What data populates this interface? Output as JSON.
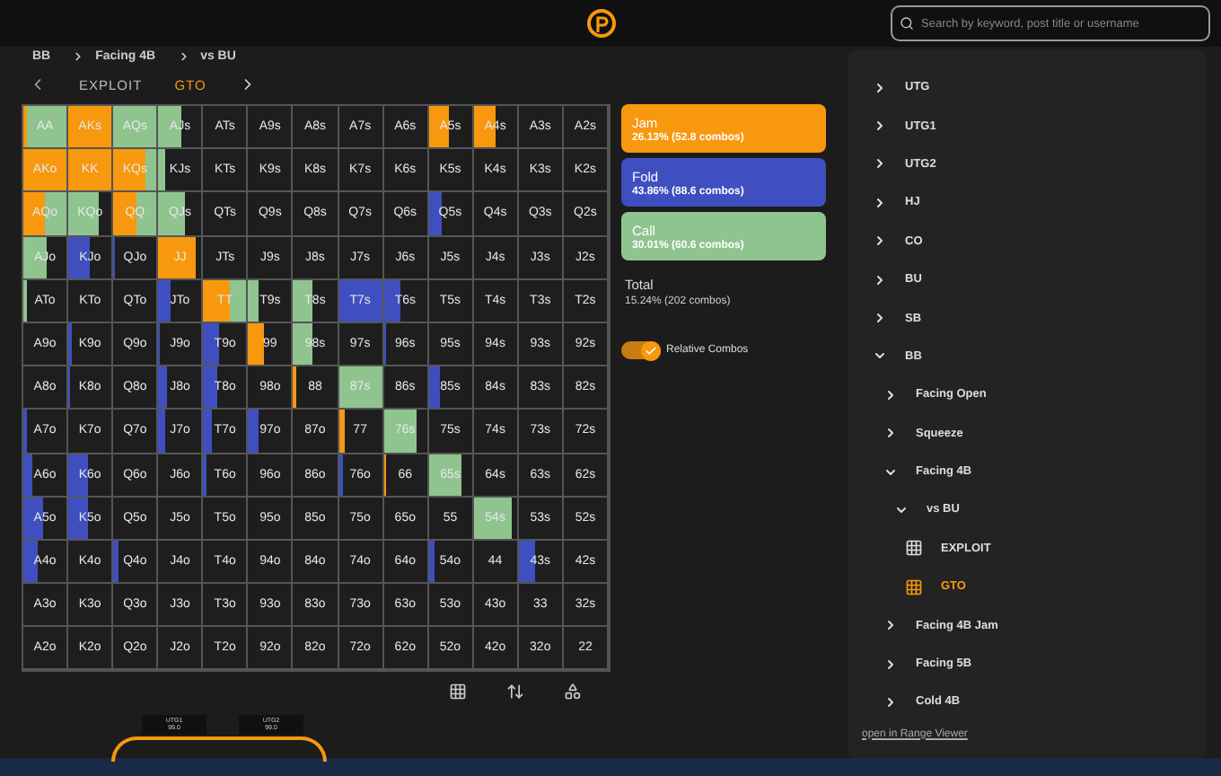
{
  "search": {
    "placeholder": "Search by keyword, post title or username"
  },
  "breadcrumbs": [
    "BB",
    "Facing 4B",
    "vs BU"
  ],
  "tabs": [
    {
      "label": "EXPLOIT",
      "selected": false
    },
    {
      "label": "GTO",
      "selected": true
    }
  ],
  "grid": [
    [
      {
        "hand": "AA",
        "mix": [
          {
            "kind": "jam",
            "level": 0.1
          },
          {
            "kind": "call",
            "level": 0.9
          }
        ]
      },
      {
        "hand": "AKs",
        "mix": [
          {
            "kind": "jam",
            "level": 1
          }
        ]
      },
      {
        "hand": "AQs",
        "mix": [
          {
            "kind": "call",
            "level": 1
          }
        ]
      },
      {
        "hand": "AJs",
        "mix": [
          {
            "kind": "call",
            "level": 0.55
          }
        ]
      },
      {
        "hand": "ATs"
      },
      {
        "hand": "A9s"
      },
      {
        "hand": "A8s"
      },
      {
        "hand": "A7s"
      },
      {
        "hand": "A6s"
      },
      {
        "hand": "A5s",
        "mix": [
          {
            "kind": "jam",
            "level": 0.45
          }
        ]
      },
      {
        "hand": "A4s",
        "mix": [
          {
            "kind": "jam",
            "level": 0.5
          }
        ]
      },
      {
        "hand": "A3s"
      },
      {
        "hand": "A2s"
      }
    ],
    [
      {
        "hand": "AKo",
        "mix": [
          {
            "kind": "jam",
            "level": 1
          }
        ]
      },
      {
        "hand": "KK",
        "mix": [
          {
            "kind": "jam",
            "level": 1
          }
        ]
      },
      {
        "hand": "KQs",
        "mix": [
          {
            "kind": "jam",
            "level": 0.75
          },
          {
            "kind": "call",
            "level": 0.25
          }
        ]
      },
      {
        "hand": "KJs",
        "mix": [
          {
            "kind": "call",
            "level": 0.15
          }
        ]
      },
      {
        "hand": "KTs"
      },
      {
        "hand": "K9s"
      },
      {
        "hand": "K8s"
      },
      {
        "hand": "K7s"
      },
      {
        "hand": "K6s"
      },
      {
        "hand": "K5s"
      },
      {
        "hand": "K4s"
      },
      {
        "hand": "K3s"
      },
      {
        "hand": "K2s"
      }
    ],
    [
      {
        "hand": "AQo",
        "mix": [
          {
            "kind": "jam",
            "level": 0.5
          },
          {
            "kind": "call",
            "level": 0.5
          }
        ]
      },
      {
        "hand": "KQo",
        "mix": [
          {
            "kind": "call",
            "level": 0.7
          }
        ]
      },
      {
        "hand": "QQ",
        "mix": [
          {
            "kind": "jam",
            "level": 0.55
          },
          {
            "kind": "call",
            "level": 0.45
          }
        ]
      },
      {
        "hand": "QJs",
        "mix": [
          {
            "kind": "call",
            "level": 0.6
          }
        ]
      },
      {
        "hand": "QTs"
      },
      {
        "hand": "Q9s"
      },
      {
        "hand": "Q8s"
      },
      {
        "hand": "Q7s"
      },
      {
        "hand": "Q6s"
      },
      {
        "hand": "Q5s",
        "mix": [
          {
            "kind": "fold",
            "level": 0.3
          }
        ]
      },
      {
        "hand": "Q4s"
      },
      {
        "hand": "Q3s"
      },
      {
        "hand": "Q2s"
      }
    ],
    [
      {
        "hand": "AJo",
        "mix": [
          {
            "kind": "call",
            "level": 0.55
          }
        ]
      },
      {
        "hand": "KJo",
        "mix": [
          {
            "kind": "fold",
            "level": 0.5
          }
        ]
      },
      {
        "hand": "QJo",
        "mix": [
          {
            "kind": "fold",
            "level": 0.05
          }
        ]
      },
      {
        "hand": "JJ",
        "mix": [
          {
            "kind": "jam",
            "level": 0.85
          }
        ]
      },
      {
        "hand": "JTs"
      },
      {
        "hand": "J9s"
      },
      {
        "hand": "J8s"
      },
      {
        "hand": "J7s"
      },
      {
        "hand": "J6s"
      },
      {
        "hand": "J5s"
      },
      {
        "hand": "J4s"
      },
      {
        "hand": "J3s"
      },
      {
        "hand": "J2s"
      }
    ],
    [
      {
        "hand": "ATo",
        "mix": [
          {
            "kind": "call",
            "level": 0.1
          }
        ]
      },
      {
        "hand": "KTo"
      },
      {
        "hand": "QTo"
      },
      {
        "hand": "JTo",
        "mix": [
          {
            "kind": "fold",
            "level": 0.3
          }
        ]
      },
      {
        "hand": "TT",
        "mix": [
          {
            "kind": "jam",
            "level": 0.6
          },
          {
            "kind": "call",
            "level": 0.4
          }
        ]
      },
      {
        "hand": "T9s",
        "mix": [
          {
            "kind": "call",
            "level": 0.25
          }
        ]
      },
      {
        "hand": "T8s",
        "mix": [
          {
            "kind": "call",
            "level": 0.45
          }
        ]
      },
      {
        "hand": "T7s",
        "mix": [
          {
            "kind": "fold",
            "level": 1
          }
        ]
      },
      {
        "hand": "T6s",
        "mix": [
          {
            "kind": "fold",
            "level": 0.4
          }
        ]
      },
      {
        "hand": "T5s"
      },
      {
        "hand": "T4s"
      },
      {
        "hand": "T3s"
      },
      {
        "hand": "T2s"
      }
    ],
    [
      {
        "hand": "A9o"
      },
      {
        "hand": "K9o",
        "mix": [
          {
            "kind": "fold",
            "level": 0.1
          }
        ]
      },
      {
        "hand": "Q9o"
      },
      {
        "hand": "J9o",
        "mix": [
          {
            "kind": "fold",
            "level": 0.05
          }
        ]
      },
      {
        "hand": "T9o",
        "mix": [
          {
            "kind": "fold",
            "level": 0.35
          }
        ]
      },
      {
        "hand": "99",
        "mix": [
          {
            "kind": "jam",
            "level": 0.35
          }
        ]
      },
      {
        "hand": "98s",
        "mix": [
          {
            "kind": "call",
            "level": 0.45
          }
        ]
      },
      {
        "hand": "97s"
      },
      {
        "hand": "96s",
        "mix": [
          {
            "kind": "fold",
            "level": 0.05
          }
        ]
      },
      {
        "hand": "95s"
      },
      {
        "hand": "94s"
      },
      {
        "hand": "93s"
      },
      {
        "hand": "92s"
      }
    ],
    [
      {
        "hand": "A8o"
      },
      {
        "hand": "K8o",
        "mix": [
          {
            "kind": "fold",
            "level": 0.05
          }
        ]
      },
      {
        "hand": "Q8o"
      },
      {
        "hand": "J8o",
        "mix": [
          {
            "kind": "fold",
            "level": 0.2
          }
        ]
      },
      {
        "hand": "T8o",
        "mix": [
          {
            "kind": "fold",
            "level": 0.3
          }
        ]
      },
      {
        "hand": "98o"
      },
      {
        "hand": "88",
        "mix": [
          {
            "kind": "jam",
            "level": 0.05
          }
        ]
      },
      {
        "hand": "87s",
        "mix": [
          {
            "kind": "call",
            "level": 1
          }
        ]
      },
      {
        "hand": "86s"
      },
      {
        "hand": "85s",
        "mix": [
          {
            "kind": "fold",
            "level": 0.25
          }
        ]
      },
      {
        "hand": "84s"
      },
      {
        "hand": "83s"
      },
      {
        "hand": "82s"
      }
    ],
    [
      {
        "hand": "A7o",
        "mix": [
          {
            "kind": "fold",
            "level": 0.1
          }
        ]
      },
      {
        "hand": "K7o"
      },
      {
        "hand": "Q7o"
      },
      {
        "hand": "J7o",
        "mix": [
          {
            "kind": "fold",
            "level": 0.15
          }
        ]
      },
      {
        "hand": "T7o",
        "mix": [
          {
            "kind": "fold",
            "level": 0.2
          }
        ]
      },
      {
        "hand": "97o",
        "mix": [
          {
            "kind": "fold",
            "level": 0.25
          }
        ]
      },
      {
        "hand": "87o"
      },
      {
        "hand": "77",
        "mix": [
          {
            "kind": "jam",
            "level": 0.15
          }
        ]
      },
      {
        "hand": "76s",
        "mix": [
          {
            "kind": "call",
            "level": 0.75
          }
        ]
      },
      {
        "hand": "75s"
      },
      {
        "hand": "74s"
      },
      {
        "hand": "73s"
      },
      {
        "hand": "72s"
      }
    ],
    [
      {
        "hand": "A6o",
        "mix": [
          {
            "kind": "fold",
            "level": 0.2
          }
        ]
      },
      {
        "hand": "K6o",
        "mix": [
          {
            "kind": "fold",
            "level": 0.45
          }
        ]
      },
      {
        "hand": "Q6o"
      },
      {
        "hand": "J6o"
      },
      {
        "hand": "T6o",
        "mix": [
          {
            "kind": "fold",
            "level": 0.05
          }
        ]
      },
      {
        "hand": "96o"
      },
      {
        "hand": "86o"
      },
      {
        "hand": "76o",
        "mix": [
          {
            "kind": "fold",
            "level": 0.1
          }
        ]
      },
      {
        "hand": "66",
        "mix": [
          {
            "kind": "jam",
            "level": 0.05
          }
        ]
      },
      {
        "hand": "65s",
        "mix": [
          {
            "kind": "call",
            "level": 0.75
          }
        ]
      },
      {
        "hand": "64s"
      },
      {
        "hand": "63s"
      },
      {
        "hand": "62s"
      }
    ],
    [
      {
        "hand": "A5o",
        "mix": [
          {
            "kind": "fold",
            "level": 0.45
          }
        ]
      },
      {
        "hand": "K5o",
        "mix": [
          {
            "kind": "fold",
            "level": 0.45
          }
        ]
      },
      {
        "hand": "Q5o"
      },
      {
        "hand": "J5o"
      },
      {
        "hand": "T5o"
      },
      {
        "hand": "95o"
      },
      {
        "hand": "85o"
      },
      {
        "hand": "75o"
      },
      {
        "hand": "65o"
      },
      {
        "hand": "55"
      },
      {
        "hand": "54s",
        "mix": [
          {
            "kind": "call",
            "level": 0.9
          }
        ]
      },
      {
        "hand": "53s"
      },
      {
        "hand": "52s"
      }
    ],
    [
      {
        "hand": "A4o",
        "mix": [
          {
            "kind": "fold",
            "level": 0.35
          }
        ]
      },
      {
        "hand": "K4o"
      },
      {
        "hand": "Q4o",
        "mix": [
          {
            "kind": "fold",
            "level": 0.1
          }
        ]
      },
      {
        "hand": "J4o"
      },
      {
        "hand": "T4o"
      },
      {
        "hand": "94o"
      },
      {
        "hand": "84o"
      },
      {
        "hand": "74o"
      },
      {
        "hand": "64o"
      },
      {
        "hand": "54o",
        "mix": [
          {
            "kind": "fold",
            "level": 0.15
          }
        ]
      },
      {
        "hand": "44"
      },
      {
        "hand": "43s",
        "mix": [
          {
            "kind": "fold",
            "level": 0.4
          }
        ]
      },
      {
        "hand": "42s"
      }
    ],
    [
      {
        "hand": "A3o"
      },
      {
        "hand": "K3o"
      },
      {
        "hand": "Q3o"
      },
      {
        "hand": "J3o"
      },
      {
        "hand": "T3o"
      },
      {
        "hand": "93o"
      },
      {
        "hand": "83o"
      },
      {
        "hand": "73o"
      },
      {
        "hand": "63o"
      },
      {
        "hand": "53o"
      },
      {
        "hand": "43o"
      },
      {
        "hand": "33"
      },
      {
        "hand": "32s"
      }
    ],
    [
      {
        "hand": "A2o"
      },
      {
        "hand": "K2o"
      },
      {
        "hand": "Q2o"
      },
      {
        "hand": "J2o"
      },
      {
        "hand": "T2o"
      },
      {
        "hand": "92o"
      },
      {
        "hand": "82o"
      },
      {
        "hand": "72o"
      },
      {
        "hand": "62o"
      },
      {
        "hand": "52o"
      },
      {
        "hand": "42o"
      },
      {
        "hand": "32o"
      },
      {
        "hand": "22"
      }
    ]
  ],
  "legend": [
    {
      "kind": "jam",
      "label": "Jam",
      "detail": "26.13% (52.8 combos)"
    },
    {
      "kind": "fold",
      "label": "Fold",
      "detail": "43.86% (88.6 combos)"
    },
    {
      "kind": "call",
      "label": "Call",
      "detail": "30.01% (60.6 combos)"
    }
  ],
  "total": {
    "label": "Total",
    "detail": "15.24% (202 combos)"
  },
  "relative_combos": {
    "label": "Relative Combos",
    "on": true
  },
  "tree": [
    {
      "kind": "folder",
      "label": "UTG",
      "expanded": false
    },
    {
      "kind": "folder",
      "label": "UTG1",
      "expanded": false
    },
    {
      "kind": "folder",
      "label": "UTG2",
      "expanded": false
    },
    {
      "kind": "folder",
      "label": "HJ",
      "expanded": false
    },
    {
      "kind": "folder",
      "label": "CO",
      "expanded": false
    },
    {
      "kind": "folder",
      "label": "BU",
      "expanded": false
    },
    {
      "kind": "folder",
      "label": "SB",
      "expanded": false
    },
    {
      "kind": "folder",
      "label": "BB",
      "expanded": true,
      "children": [
        {
          "kind": "folder",
          "label": "Facing Open",
          "expanded": false
        },
        {
          "kind": "folder",
          "label": "Squeeze",
          "expanded": false
        },
        {
          "kind": "folder",
          "label": "Facing 4B",
          "expanded": true,
          "children": [
            {
              "kind": "folder",
              "label": "vs BU",
              "expanded": true,
              "children": [
                {
                  "kind": "range",
                  "label": "EXPLOIT",
                  "selected": false
                },
                {
                  "kind": "range",
                  "label": "GTO",
                  "selected": true
                }
              ]
            }
          ]
        },
        {
          "kind": "folder",
          "label": "Facing 4B Jam",
          "expanded": false
        },
        {
          "kind": "folder",
          "label": "Facing 5B",
          "expanded": false
        },
        {
          "kind": "folder",
          "label": "Cold 4B",
          "expanded": false
        }
      ]
    }
  ],
  "viewer_link": "open in Range Viewer",
  "seats": [
    {
      "name": "UTG1",
      "stack": "99.0"
    },
    {
      "name": "UTG2",
      "stack": "99.0"
    }
  ]
}
